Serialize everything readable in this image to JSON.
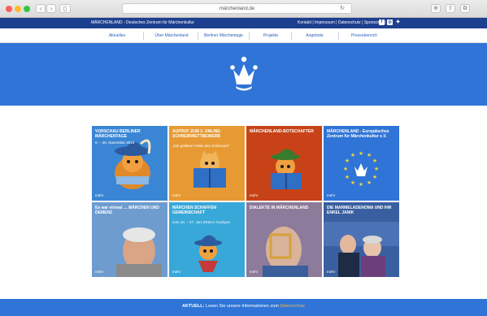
{
  "browser": {
    "url": "märchenland.de"
  },
  "topbar": {
    "site_name": "MÄRCHENLAND - Deutsches Zentrum für Märchenkultur",
    "links": "Kontakt | Impressum | Datenschutz | Sponsoren |",
    "social": [
      "facebook-icon",
      "instagram-icon",
      "twitter-icon"
    ]
  },
  "menu": {
    "items": [
      "Aktuelles",
      "Über Märchenland",
      "Berliner Märchentage",
      "Projekte",
      "Angebote",
      "Pressebereich"
    ]
  },
  "tiles": [
    {
      "title": "VORSCHAU BERLINER MÄRCHENTAGE",
      "sub": "8. – 26. November 2016",
      "more": "mehr",
      "color": "#3a86d4"
    },
    {
      "title": "AUFRUF ZUM 3. ONLINE-SCHREIBWETTBEWERB",
      "sub": "„Die goldene Feder des Schlosses“",
      "more": "mehr",
      "color": "#e79a33"
    },
    {
      "title": "MÄRCHENLAND-BOTSCHAFTER",
      "sub": "",
      "more": "mehr",
      "color": "#c84218"
    },
    {
      "title": "MÄRCHENLAND - Europäisches Zentrum für Märchenkultur e.V.",
      "sub": "",
      "more": "mehr",
      "color": "#2f74d6"
    },
    {
      "title": "Es war einmal … MÄRCHEN UND DEMENZ",
      "sub": "",
      "more": "mehr",
      "color": "#5a8fc8"
    },
    {
      "title": "MÄRCHEN SCHAFFEN GEMEINSCHAFT",
      "sub": "vom 13. – 27. Juni 2015 in Gorbyes",
      "more": "mehr",
      "color": "#38a8d8"
    },
    {
      "title": "DIALEKTE IN MÄRCHENLAND",
      "sub": "",
      "more": "mehr",
      "color": "#7b6a8c"
    },
    {
      "title": "DIE MARMELADENOMA UND IHR ENKEL JANIK",
      "sub": "",
      "more": "mehr",
      "color": "#2c4f8a"
    }
  ],
  "footer": {
    "label": "AKTUELL:",
    "text": " Lesen Sie unsere Informationen zum ",
    "link": "Datenschutz"
  }
}
